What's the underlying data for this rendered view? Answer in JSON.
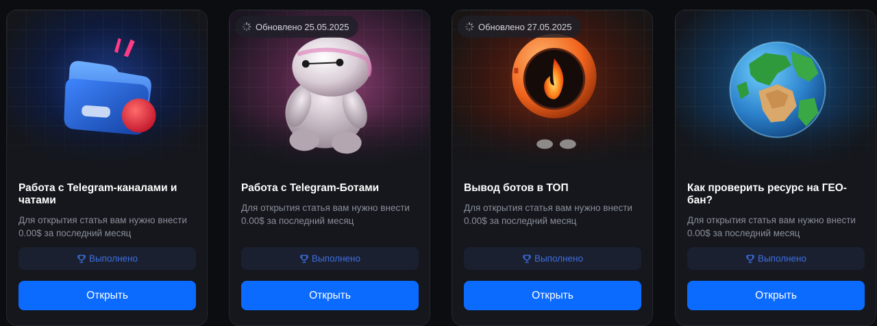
{
  "cards": [
    {
      "badge": "",
      "title": "Работа с Telegram-каналами и чатами",
      "description": "Для открытия статья вам нужно внести 0.00$ за последний месяц",
      "status_label": "Выполнено",
      "open_label": "Открыть",
      "image_icon": "telegram-folder-icon"
    },
    {
      "badge": "Обновлено 25.05.2025",
      "title": "Работа с Telegram-Ботами",
      "description": "Для открытия статья вам нужно внести 0.00$ за последний месяц",
      "status_label": "Выполнено",
      "open_label": "Открыть",
      "image_icon": "robot-figure-icon"
    },
    {
      "badge": "Обновлено 27.05.2025",
      "title": "Вывод ботов в ТОП",
      "description": "Для открытия статья вам нужно внести 0.00$ за последний месяц",
      "status_label": "Выполнено",
      "open_label": "Открыть",
      "image_icon": "fire-robot-icon"
    },
    {
      "badge": "",
      "title": "Как проверить ресурс на ГЕО-бан?",
      "description": "Для открытия статья вам нужно внести 0.00$ за последний месяц",
      "status_label": "Выполнено",
      "open_label": "Открыть",
      "image_icon": "globe-icon"
    }
  ],
  "colors": {
    "page_bg": "#0c0d10",
    "card_bg": "#15171c",
    "accent": "#0b6bff",
    "status_text": "#3e6ee0"
  }
}
